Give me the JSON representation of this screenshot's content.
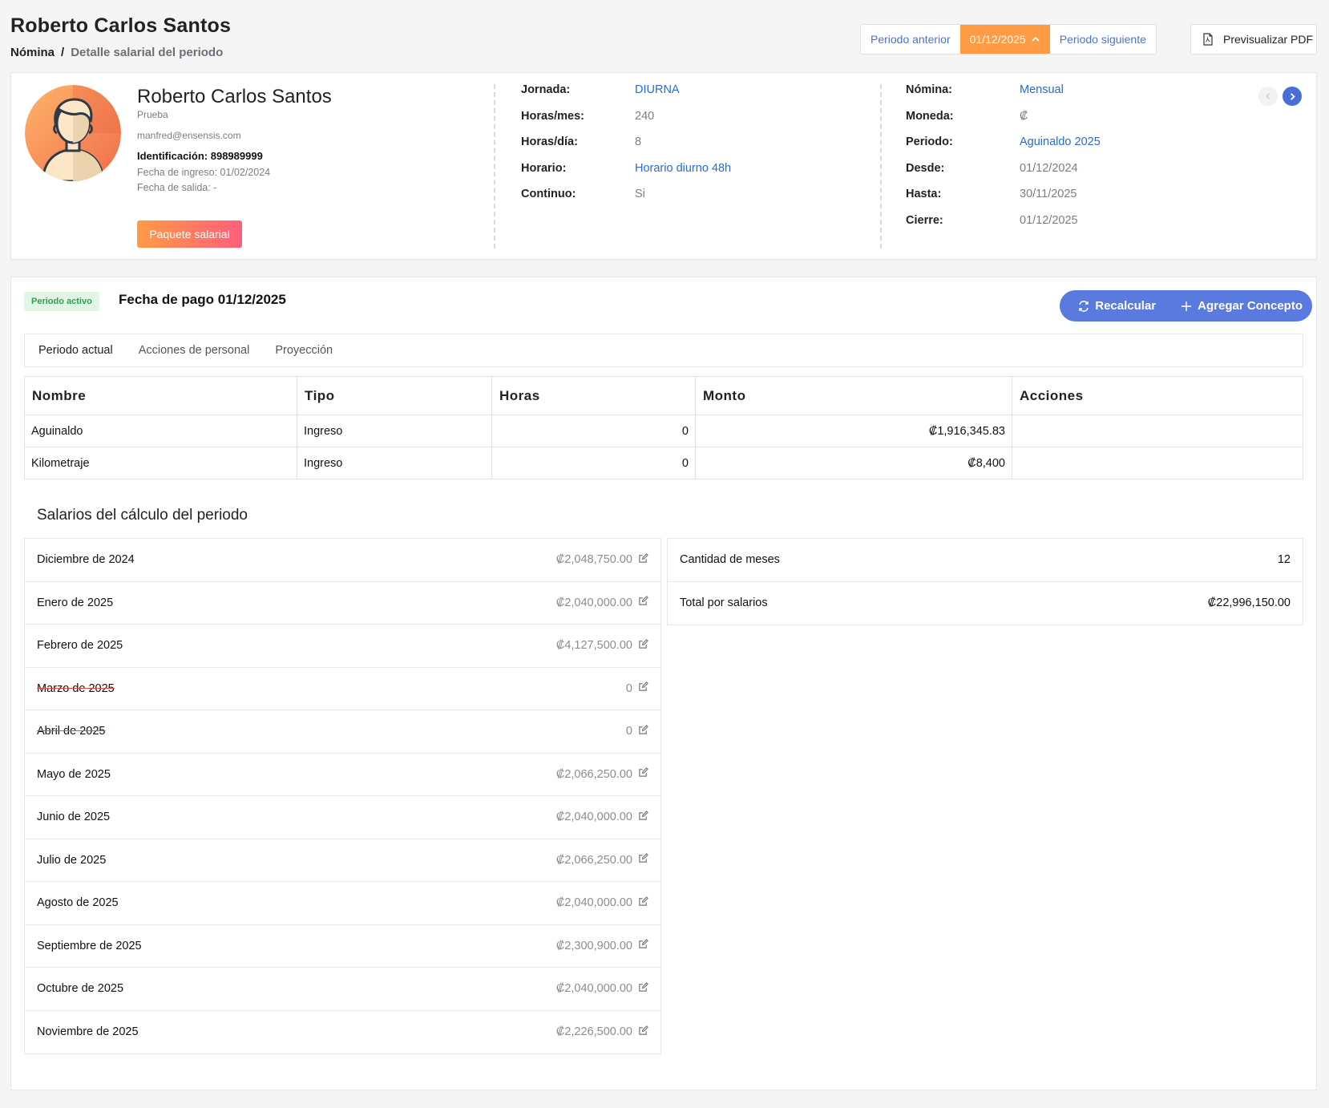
{
  "header": {
    "title": "Roberto Carlos Santos",
    "breadcrumb": {
      "main": "Nómina",
      "sep": "/",
      "current": "Detalle salarial del periodo"
    },
    "period_nav": {
      "prev_label": "Periodo anterior",
      "current_label": "01/12/2025",
      "next_label": "Periodo siguiente"
    },
    "pdf_label": "Previsualizar PDF"
  },
  "employee": {
    "name": "Roberto Carlos Santos",
    "subtitle": "Prueba",
    "email": "manfred@ensensis.com",
    "identification": "Identificación: 898989999",
    "fecha_ingreso": "Fecha de ingreso: 01/02/2024",
    "fecha_salida": "Fecha de salida: -",
    "paquete_label": "Paquete salarial",
    "col1": [
      {
        "label": "Jornada:",
        "value": "DIURNA",
        "link": true
      },
      {
        "label": "Horas/mes:",
        "value": "240",
        "link": false
      },
      {
        "label": "Horas/día:",
        "value": "8",
        "link": false
      },
      {
        "label": "Horario:",
        "value": "Horario diurno 48h",
        "link": true
      },
      {
        "label": "Continuo:",
        "value": "Si",
        "link": false
      }
    ],
    "col2": [
      {
        "label": "Nómina:",
        "value": "Mensual",
        "link": true
      },
      {
        "label": "Moneda:",
        "value": "₡",
        "link": false
      },
      {
        "label": "Periodo:",
        "value": "Aguinaldo 2025",
        "link": true
      },
      {
        "label": "Desde:",
        "value": "01/12/2024",
        "link": false
      },
      {
        "label": "Hasta:",
        "value": "30/11/2025",
        "link": false
      },
      {
        "label": "Cierre:",
        "value": "01/12/2025",
        "link": false
      }
    ]
  },
  "period": {
    "badge": "Periodo activo",
    "pay_date": "Fecha de pago 01/12/2025",
    "recalcular_label": "Recalcular",
    "agregar_label": "Agregar Concepto",
    "tabs": [
      {
        "label": "Periodo actual",
        "active": true
      },
      {
        "label": "Acciones de personal",
        "active": false
      },
      {
        "label": "Proyección",
        "active": false
      }
    ],
    "table": {
      "headers": [
        "Nombre",
        "Tipo",
        "Horas",
        "Monto",
        "Acciones"
      ],
      "rows": [
        {
          "nombre": "Aguinaldo",
          "tipo": "Ingreso",
          "horas": "0",
          "monto": "₡1,916,345.83",
          "acciones": ""
        },
        {
          "nombre": "Kilometraje",
          "tipo": "Ingreso",
          "horas": "0",
          "monto": "₡8,400",
          "acciones": ""
        }
      ]
    }
  },
  "salaries": {
    "title": "Salarios del cálculo del periodo",
    "months": [
      {
        "name": "Diciembre de 2024",
        "amount": "₡2,048,750.00",
        "struck": false
      },
      {
        "name": "Enero de 2025",
        "amount": "₡2,040,000.00",
        "struck": false
      },
      {
        "name": "Febrero de 2025",
        "amount": "₡4,127,500.00",
        "struck": false
      },
      {
        "name": "Marzo de 2025",
        "amount": "0",
        "struck": true
      },
      {
        "name": "Abril de 2025",
        "amount": "0",
        "struck": true
      },
      {
        "name": "Mayo de 2025",
        "amount": "₡2,066,250.00",
        "struck": false
      },
      {
        "name": "Junio de 2025",
        "amount": "₡2,040,000.00",
        "struck": false
      },
      {
        "name": "Julio de 2025",
        "amount": "₡2,066,250.00",
        "struck": false
      },
      {
        "name": "Agosto de 2025",
        "amount": "₡2,040,000.00",
        "struck": false
      },
      {
        "name": "Septiembre de 2025",
        "amount": "₡2,300,900.00",
        "struck": false
      },
      {
        "name": "Octubre de 2025",
        "amount": "₡2,040,000.00",
        "struck": false
      },
      {
        "name": "Noviembre de 2025",
        "amount": "₡2,226,500.00",
        "struck": false
      }
    ],
    "summary": [
      {
        "label": "Cantidad de meses",
        "value": "12"
      },
      {
        "label": "Total por salarios",
        "value": "₡22,996,150.00"
      }
    ]
  },
  "colors": {
    "accent_orange": "#ff9b45",
    "primary_blue": "#5b7ae0",
    "link_blue": "#2a6ad6",
    "strike_red": "#e34a4a",
    "badge_green": "#2fa04a"
  },
  "icons": [
    "chevron-up-icon",
    "pdf-file-icon",
    "chevron-left-icon",
    "chevron-right-icon",
    "refresh-icon",
    "plus-icon",
    "edit-icon",
    "avatar-icon"
  ]
}
